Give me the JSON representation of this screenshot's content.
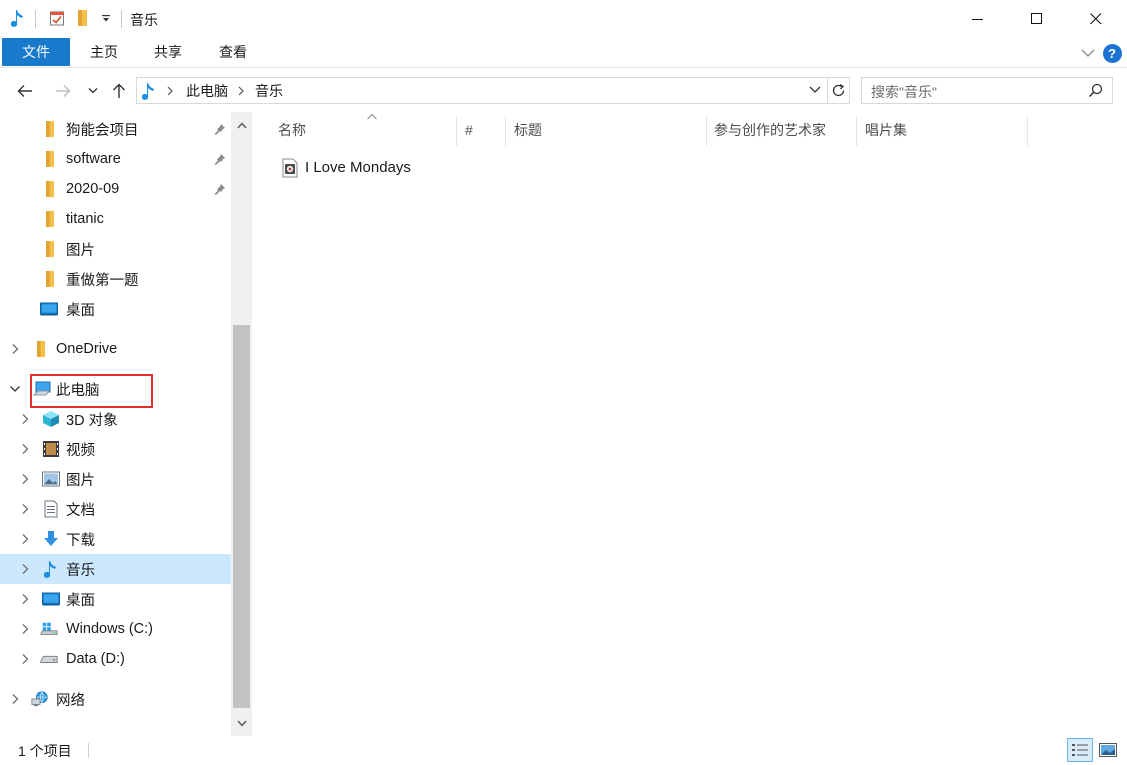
{
  "window": {
    "title": "音乐",
    "minimize_symbol": "—",
    "maximize_symbol": "☐",
    "close_symbol": "✕"
  },
  "ribbon": {
    "tabs": [
      "文件",
      "主页",
      "共享",
      "查看"
    ],
    "help_symbol": "?",
    "accent_color": "#1979ca"
  },
  "address": {
    "segments": [
      "此电脑",
      "音乐"
    ],
    "search_placeholder": "搜索\"音乐\""
  },
  "nav": {
    "quick_access": [
      {
        "label": "狗能会项目",
        "icon": "folder-icon",
        "pinned": true
      },
      {
        "label": "software",
        "icon": "folder-icon",
        "pinned": true
      },
      {
        "label": "2020-09",
        "icon": "folder-icon",
        "pinned": true
      },
      {
        "label": "titanic",
        "icon": "folder-icon",
        "pinned": false
      },
      {
        "label": "图片",
        "icon": "folder-icon",
        "pinned": false
      },
      {
        "label": "重做第一题",
        "icon": "folder-icon",
        "pinned": false
      },
      {
        "label": "桌面",
        "icon": "desktop-icon",
        "pinned": false
      }
    ],
    "onedrive": "OneDrive",
    "this_pc": "此电脑",
    "pc_items": [
      {
        "label": "3D 对象",
        "icon": "cube-3d-icon"
      },
      {
        "label": "视频",
        "icon": "video-icon"
      },
      {
        "label": "图片",
        "icon": "picture-icon"
      },
      {
        "label": "文档",
        "icon": "document-icon"
      },
      {
        "label": "下载",
        "icon": "download-icon"
      },
      {
        "label": "音乐",
        "icon": "music-note-icon",
        "selected": true
      },
      {
        "label": "桌面",
        "icon": "desktop-icon"
      },
      {
        "label": "Windows (C:)",
        "icon": "windows-drive-icon"
      },
      {
        "label": "Data (D:)",
        "icon": "drive-icon"
      }
    ],
    "network": "网络",
    "selected_color": "#cce8ff",
    "highlight_color": "#e03131"
  },
  "content": {
    "columns": [
      "名称",
      "#",
      "标题",
      "参与创作的艺术家",
      "唱片集"
    ],
    "files": [
      {
        "name": "I Love Mondays",
        "icon": "audio-file-icon"
      }
    ]
  },
  "status": {
    "item_count": "1 个项目"
  }
}
